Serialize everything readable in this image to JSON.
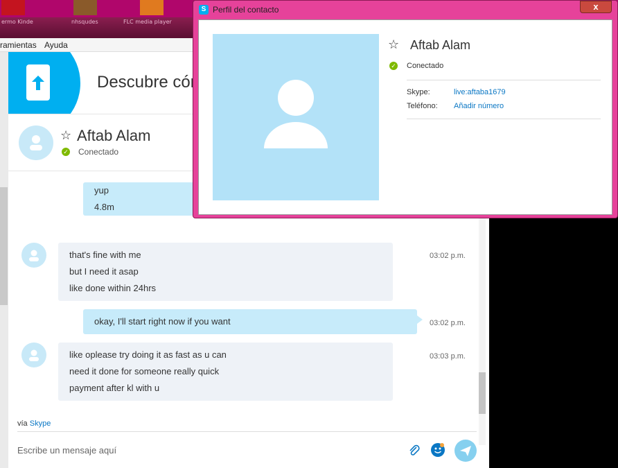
{
  "menubar": {
    "items": [
      "ramientas",
      "Ayuda"
    ]
  },
  "taskbar": {
    "labels": [
      "ermo Kinde",
      "nhsqudes",
      "FLC media player"
    ]
  },
  "banner": {
    "title": "Descubre cóm"
  },
  "contact": {
    "name": "Aftab Alam",
    "status": "Conectado"
  },
  "messages": [
    {
      "id": "m1",
      "dir": "out",
      "lines": [
        "yup",
        "4.8m"
      ]
    },
    {
      "id": "m2",
      "dir": "in",
      "lines": [
        "that's fine with me",
        "but I need it asap",
        "like done within 24hrs"
      ],
      "time": "03:02 p.m."
    },
    {
      "id": "m3",
      "dir": "out",
      "lines": [
        "okay, I'll start right now if you want"
      ],
      "time": "03:02 p.m."
    },
    {
      "id": "m4",
      "dir": "in",
      "lines": [
        "like oplease try doing it as fast as u can",
        "need it done for someone really quick",
        "payment after kl with u"
      ],
      "time": "03:03 p.m."
    }
  ],
  "footer": {
    "via_prefix": "vía",
    "via_link": "Skype",
    "placeholder": "Escribe un mensaje aquí"
  },
  "popup": {
    "title": "Perfil del contacto",
    "close": "x",
    "name": "Aftab Alam",
    "status": "Conectado",
    "skype_label": "Skype:",
    "skype_value": "live:aftaba1679",
    "phone_label": "Teléfono:",
    "phone_value": "Añadir número"
  },
  "colors": {
    "accent": "#00aff0",
    "online": "#7fba00",
    "popup_frame": "#e6429a",
    "link": "#0a77c4"
  }
}
